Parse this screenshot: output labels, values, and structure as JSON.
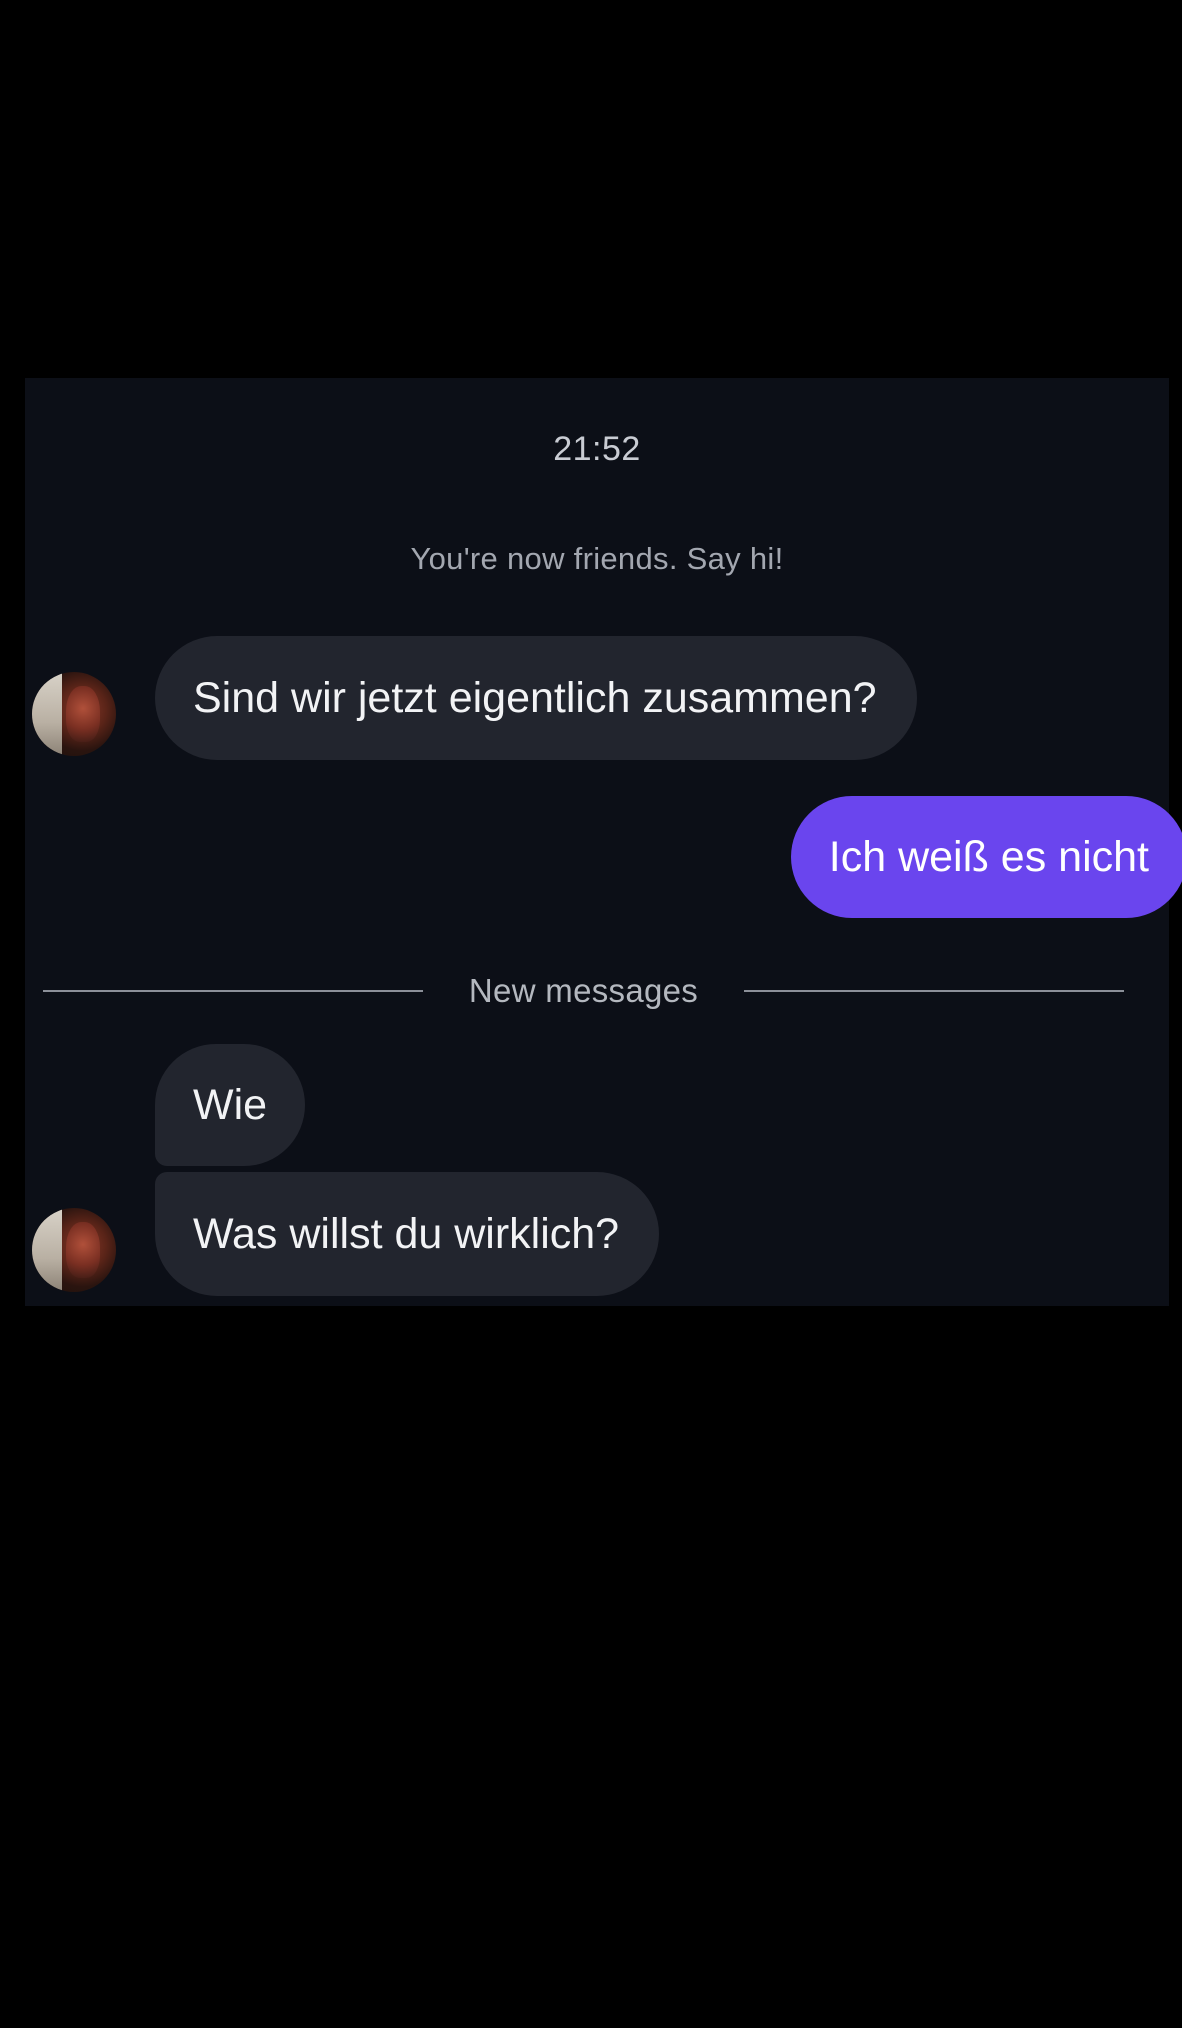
{
  "chat": {
    "timestamp": "21:52",
    "system_message": "You're now friends. Say hi!",
    "divider_label": "New messages",
    "messages": [
      {
        "direction": "incoming",
        "text": "Sind wir jetzt eigentlich zusammen?",
        "avatar": "avatar-photo"
      },
      {
        "direction": "outgoing",
        "text": "Ich weiß es nicht"
      },
      {
        "direction": "incoming",
        "text": "Wie"
      },
      {
        "direction": "incoming",
        "text": "Was willst du wirklich?",
        "avatar": "avatar-photo"
      }
    ]
  },
  "colors": {
    "background": "#000000",
    "chat_panel": "#0c0f17",
    "incoming_bubble": "#22252e",
    "outgoing_bubble": "#6a45ee"
  }
}
